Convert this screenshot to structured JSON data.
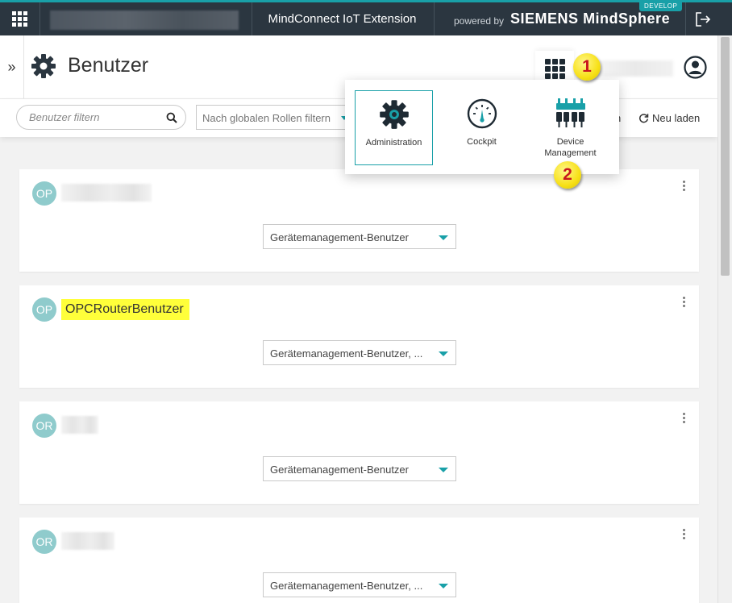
{
  "topbar": {
    "product": "MindConnect IoT Extension",
    "powered_by": "powered by",
    "brand": "SIEMENS MindSphere",
    "env_badge": "DEVELOP",
    "apps_icon": "grid-icon",
    "logout_icon": "logout-icon"
  },
  "header": {
    "nav_toggle": "»",
    "title": "Benutzer",
    "page_icon": "gear-icon",
    "apps_icon": "grid-icon",
    "user_icon": "user-circle-icon"
  },
  "filters": {
    "search_placeholder": "Benutzer filtern",
    "roles_placeholder": "Nach globalen Rollen filtern",
    "partial_label": "n",
    "reload_label": "Neu laden"
  },
  "app_switcher": {
    "apps": [
      {
        "label": "Administration",
        "icon": "gear-icon",
        "active": true
      },
      {
        "label": "Cockpit",
        "icon": "gauge-icon",
        "active": false
      },
      {
        "label": "Device Management",
        "icon": "device-icon",
        "active": false
      }
    ]
  },
  "steps": {
    "step1": "1",
    "step2": "2"
  },
  "users": [
    {
      "initials": "OP",
      "name": "",
      "roles": "Gerätemanagement-Benutzer"
    },
    {
      "initials": "OP",
      "name": "OPCRouterBenutzer",
      "roles": "Gerätemanagement-Benutzer, ..."
    },
    {
      "initials": "OR",
      "name": "",
      "roles": "Gerätemanagement-Benutzer"
    },
    {
      "initials": "OR",
      "name": "",
      "roles": "Gerätemanagement-Benutzer, ..."
    }
  ],
  "colors": {
    "topbar": "#2b3640",
    "accent": "#19a0a8",
    "avatar": "#8fcbcc",
    "highlight": "#ffff3a",
    "badge": "#f7e017",
    "badge_text": "#c8161d"
  }
}
